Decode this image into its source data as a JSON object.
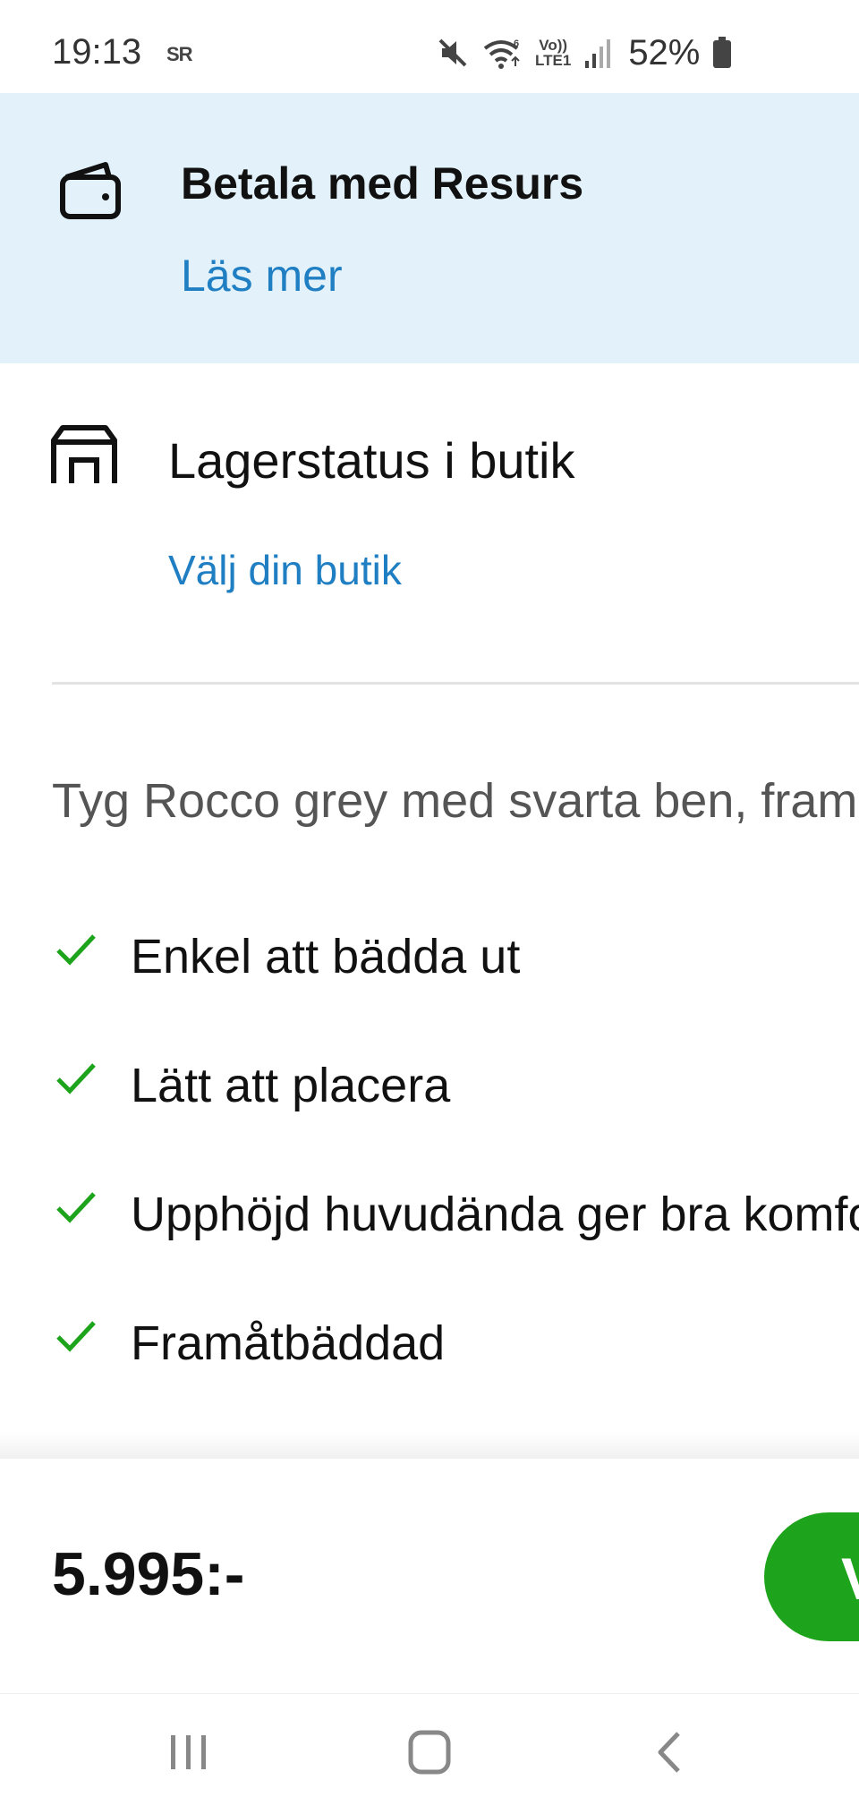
{
  "status_bar": {
    "time": "19:13",
    "sr_label": "SR",
    "volte_top": "Vo))",
    "volte_bottom": "LTE1",
    "battery": "52%",
    "icons": [
      "mute-icon",
      "wifi-icon",
      "volte-icon",
      "signal-icon",
      "battery-icon"
    ]
  },
  "resurs": {
    "icon": "wallet-icon",
    "title": "Betala med Resurs",
    "link": "Läs mer",
    "background": "#e3f2fa"
  },
  "stock": {
    "icon": "store-icon",
    "title": "Lagerstatus i butik",
    "link": "Välj din butik"
  },
  "description": "Tyg Rocco grey med svarta ben, framåtbäddad",
  "features": [
    "Enkel att bädda ut",
    "Lätt att placera",
    "Upphöjd huvudända ger bra komfort",
    "Framåtbäddad"
  ],
  "price_bar": {
    "price": "5.995:-",
    "buy_label": "V",
    "button_color": "#1ea41c"
  },
  "nav_bar": {
    "icons": [
      "recents-icon",
      "home-icon",
      "back-icon"
    ]
  },
  "colors": {
    "link": "#1f7fc2",
    "check": "#1ea41c"
  }
}
